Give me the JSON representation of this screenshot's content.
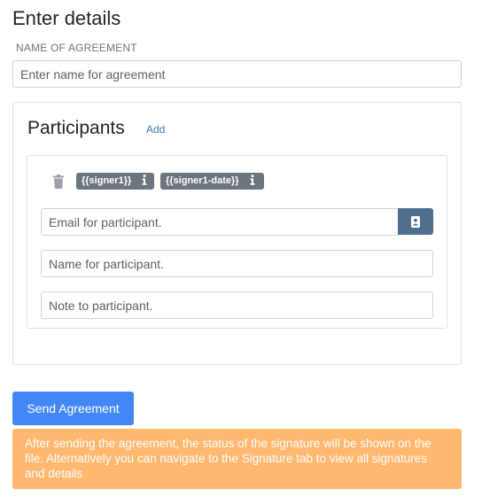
{
  "page": {
    "title": "Enter details"
  },
  "agreement": {
    "label": "NAME OF AGREEMENT",
    "placeholder": "Enter name for agreement",
    "value": ""
  },
  "participants": {
    "title": "Participants",
    "add_label": "Add",
    "items": [
      {
        "tags": [
          {
            "text": "{{signer1}}",
            "icon": "info-icon"
          },
          {
            "text": "{{signer1-date}}",
            "icon": "info-icon"
          }
        ],
        "delete_icon": "trash-icon",
        "email": {
          "placeholder": "Email for participant.",
          "value": ""
        },
        "contact_icon": "address-book-icon",
        "name": {
          "placeholder": "Name for participant.",
          "value": ""
        },
        "note": {
          "placeholder": "Note to participant.",
          "value": ""
        }
      }
    ]
  },
  "actions": {
    "send_label": "Send Agreement"
  },
  "banner": {
    "text": "After sending the agreement, the status of the signature will be shown on the file. Alternatively you can navigate to the Signature tab to view all signatures and details"
  },
  "colors": {
    "primary": "#4287f5",
    "secondary_button": "#4f6f8f",
    "tag": "#6c757d",
    "banner": "#ffb870",
    "link": "#3d7ab5"
  }
}
